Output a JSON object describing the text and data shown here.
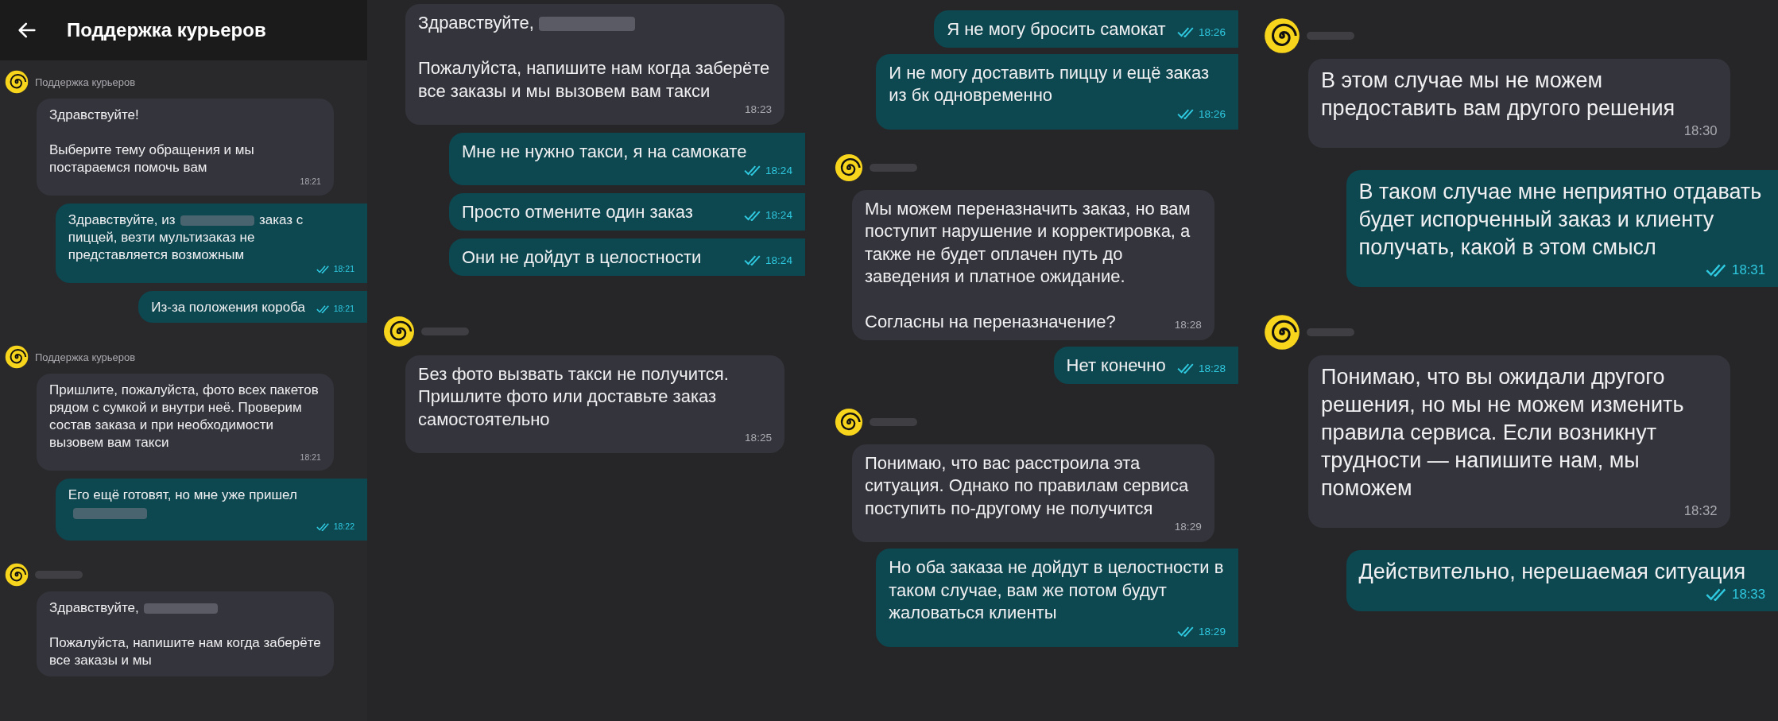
{
  "screens": [
    {
      "header": {
        "title": "Поддержка курьеров"
      },
      "messages": [
        {
          "kind": "sender",
          "name": "Поддержка курьеров"
        },
        {
          "kind": "incoming",
          "paragraphs": [
            [
              "Здравствуйте!"
            ],
            [
              "Выберите тему обращения и мы постараемся помочь вам"
            ]
          ],
          "time": "18:21"
        },
        {
          "kind": "outgoing",
          "paragraphs": [
            [
              {
                "kind": "text",
                "text": "Здравствуйте, из"
              },
              {
                "kind": "redaction"
              },
              {
                "kind": "text",
                "text": "заказ с пиццей, везти мультизаказ не представляется возможным"
              }
            ]
          ],
          "time": "18:21",
          "read": true
        },
        {
          "kind": "outgoing",
          "paragraphs": [
            [
              "Из-за положения короба"
            ]
          ],
          "time": "18:21",
          "read": true
        },
        {
          "kind": "sender",
          "name": "Поддержка курьеров"
        },
        {
          "kind": "incoming",
          "paragraphs": [
            [
              "Пришлите, пожалуйста, фото всех пакетов рядом с сумкой и внутри неё. Проверим состав заказа и при необходимости вызовем вам такси"
            ]
          ],
          "time": "18:21"
        },
        {
          "kind": "outgoing",
          "paragraphs": [
            [
              {
                "kind": "text",
                "text": "Его ещё готовят, но мне уже пришел"
              },
              {
                "kind": "redaction"
              }
            ]
          ],
          "time": "18:22",
          "read": true
        },
        {
          "kind": "sender",
          "name_blurred": true
        },
        {
          "kind": "incoming",
          "paragraphs": [
            [
              {
                "kind": "text",
                "text": "Здравствуйте,"
              },
              {
                "kind": "redaction"
              }
            ],
            [
              "Пожалуйста, напишите нам когда заберёте все заказы и мы"
            ]
          ]
        }
      ]
    },
    {
      "messages": [
        {
          "kind": "incoming",
          "paragraphs": [
            [
              {
                "kind": "text",
                "text": "Здравствуйте,"
              },
              {
                "kind": "redaction"
              }
            ],
            [
              "Пожалуйста, напишите нам когда заберёте все заказы и мы вызовем вам такси"
            ]
          ],
          "time": "18:23"
        },
        {
          "kind": "outgoing",
          "paragraphs": [
            [
              "Мне не нужно такси, я на самокате"
            ]
          ],
          "time": "18:24",
          "read": true
        },
        {
          "kind": "outgoing",
          "paragraphs": [
            [
              "Просто отмените один заказ"
            ]
          ],
          "time": "18:24",
          "read": true
        },
        {
          "kind": "outgoing",
          "paragraphs": [
            [
              "Они не дойдут в целостности"
            ]
          ],
          "time": "18:24",
          "read": true
        },
        {
          "kind": "sender",
          "name_blurred": true
        },
        {
          "kind": "incoming",
          "paragraphs": [
            [
              "Без фото вызвать такси не получится. Пришлите фото или доставьте заказ самостоятельно"
            ]
          ],
          "time": "18:25"
        }
      ]
    },
    {
      "messages": [
        {
          "kind": "outgoing",
          "paragraphs": [
            [
              "Я не могу бросить самокат"
            ]
          ],
          "time": "18:26",
          "read": true
        },
        {
          "kind": "outgoing",
          "paragraphs": [
            [
              "И не могу доставить пиццу и ещё заказ из бк одновременно"
            ]
          ],
          "time": "18:26",
          "read": true
        },
        {
          "kind": "sender",
          "name_blurred": true
        },
        {
          "kind": "incoming",
          "paragraphs": [
            [
              "Мы можем переназначить заказ, но вам поступит нарушение и корректировка, а также не будет оплачен путь до заведения и платное ожидание."
            ],
            [
              "Согласны на переназначение?"
            ]
          ],
          "time": "18:28"
        },
        {
          "kind": "outgoing",
          "paragraphs": [
            [
              "Нет конечно"
            ]
          ],
          "time": "18:28",
          "read": true
        },
        {
          "kind": "sender",
          "name_blurred": true
        },
        {
          "kind": "incoming",
          "paragraphs": [
            [
              "Понимаю, что вас расстроила эта ситуация. Однако по правилам сервиса поступить по-другому не получится"
            ]
          ],
          "time": "18:29"
        },
        {
          "kind": "outgoing",
          "paragraphs": [
            [
              "Но оба заказа не дойдут в целостности в таком случае, вам же потом будут жаловаться клиенты"
            ]
          ],
          "time": "18:29",
          "read": true
        }
      ]
    },
    {
      "messages": [
        {
          "kind": "sender",
          "name_blurred": true
        },
        {
          "kind": "incoming",
          "paragraphs": [
            [
              "В этом случае мы не можем предоставить вам другого решения"
            ]
          ],
          "time": "18:30"
        },
        {
          "kind": "outgoing",
          "paragraphs": [
            [
              "В таком случае мне неприятно отдавать будет испорченный заказ и клиенту получать, какой в этом смысл"
            ]
          ],
          "time": "18:31",
          "read": true
        },
        {
          "kind": "sender",
          "name_blurred": true
        },
        {
          "kind": "incoming",
          "paragraphs": [
            [
              "Понимаю, что вы ожидали другого решения, но мы не можем изменить правила сервиса. Если возникнут трудности — напишите нам, мы поможем"
            ]
          ],
          "time": "18:32"
        },
        {
          "kind": "outgoing",
          "paragraphs": [
            [
              "Действительно, нерешаемая ситуация"
            ]
          ],
          "time": "18:33",
          "read": true
        }
      ]
    }
  ]
}
